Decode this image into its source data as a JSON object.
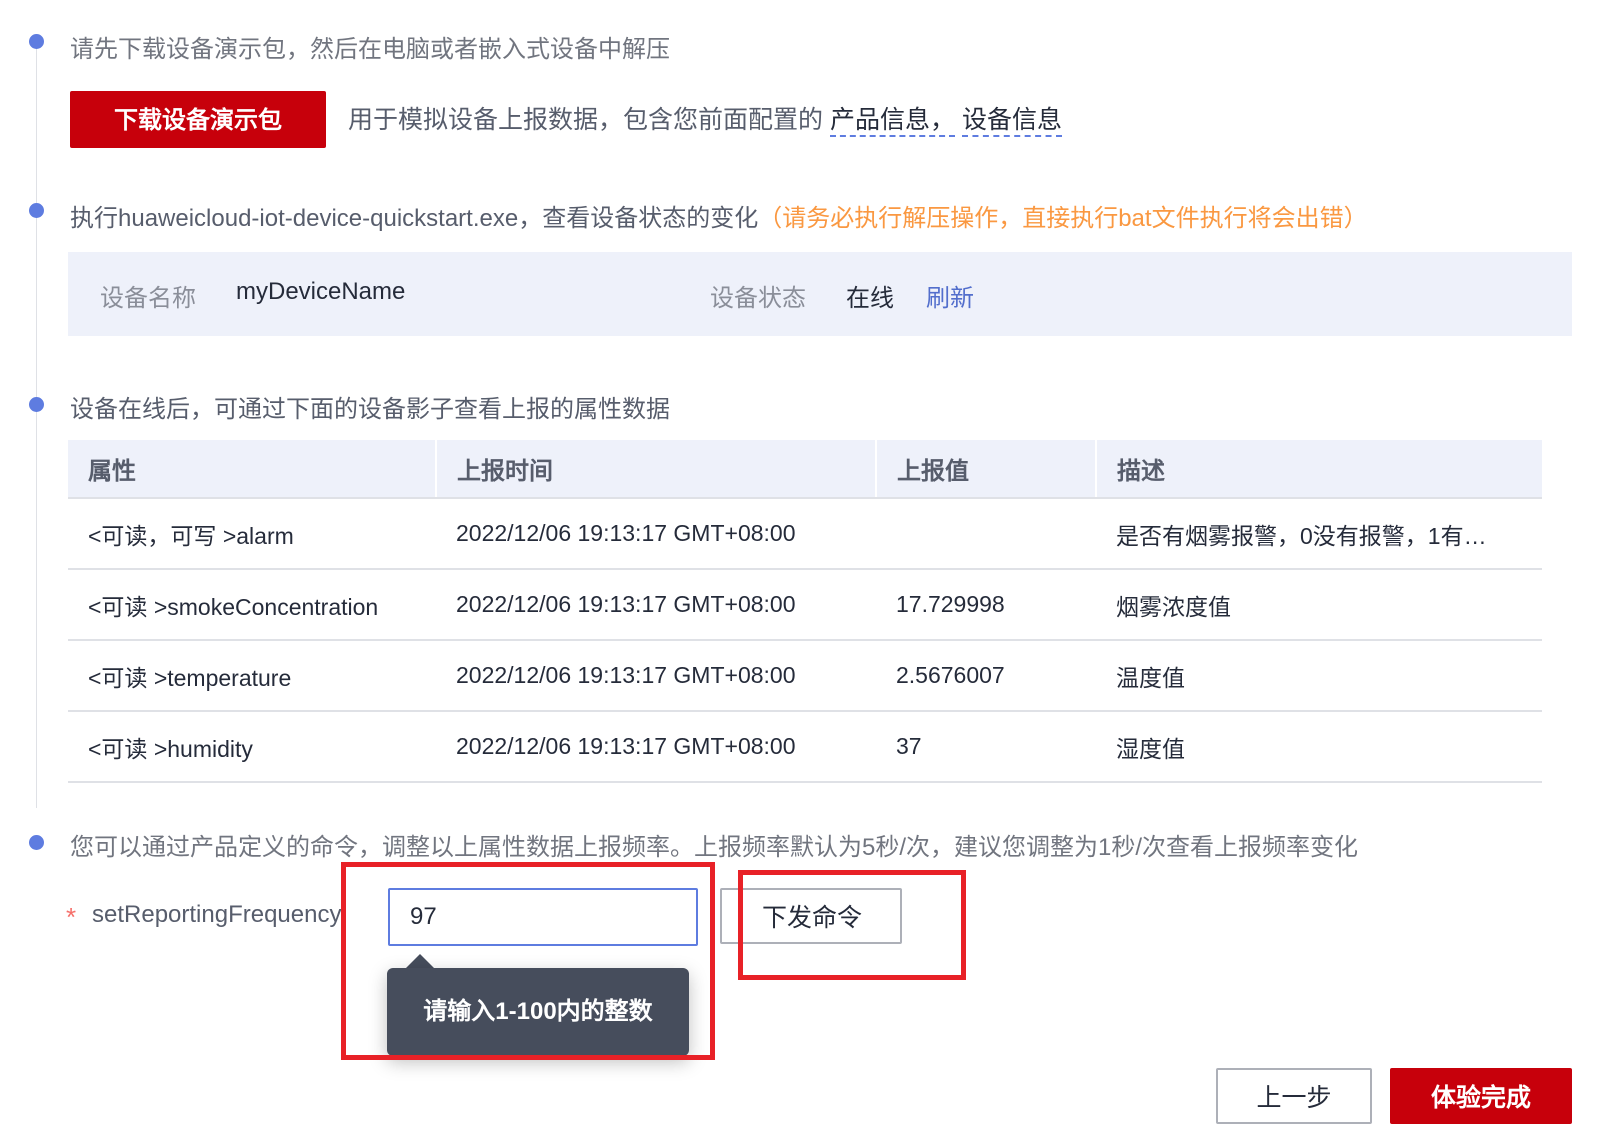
{
  "steps": [
    {
      "text": "请先下载设备演示包，然后在电脑或者嵌入式设备中解压"
    },
    {
      "text": "执行huaweicloud-iot-device-quickstart.exe，查看设备状态的变化",
      "warning": "（请务必执行解压操作，直接执行bat文件执行将会出错）"
    },
    {
      "text": "设备在线后，可通过下面的设备影子查看上报的属性数据"
    },
    {
      "text": "您可以通过产品定义的命令，调整以上属性数据上报频率。上报频率默认为5秒/次，建议您调整为1秒/次查看上报频率变化"
    }
  ],
  "download": {
    "button_label": "下载设备演示包",
    "description": "用于模拟设备上报数据，包含您前面配置的",
    "link_product": "产品信息，",
    "link_device": "设备信息"
  },
  "device_status": {
    "name_label": "设备名称",
    "name_value": "myDeviceName",
    "status_label": "设备状态",
    "status_value": "在线",
    "refresh_label": "刷新"
  },
  "table": {
    "headers": [
      "属性",
      "上报时间",
      "上报值",
      "描述"
    ],
    "rows": [
      [
        "<可读，可写 >alarm",
        "2022/12/06 19:13:17 GMT+08:00",
        "",
        "是否有烟雾报警，0没有报警，1有…"
      ],
      [
        "<可读 >smokeConcentration",
        "2022/12/06 19:13:17 GMT+08:00",
        "17.729998",
        "烟雾浓度值"
      ],
      [
        "<可读 >temperature",
        "2022/12/06 19:13:17 GMT+08:00",
        "2.5676007",
        "温度值"
      ],
      [
        "<可读 >humidity",
        "2022/12/06 19:13:17 GMT+08:00",
        "37",
        "湿度值"
      ]
    ]
  },
  "command": {
    "required_mark": "*",
    "label": "setReportingFrequency",
    "input_value": "97",
    "send_label": "下发命令",
    "tooltip": "请输入1-100内的整数"
  },
  "footer": {
    "prev_label": "上一步",
    "finish_label": "体验完成"
  },
  "colors": {
    "primary_red": "#c7000b",
    "accent_blue": "#5e7ce0",
    "warning_orange": "#fa9841",
    "highlight_red": "#e82127"
  }
}
